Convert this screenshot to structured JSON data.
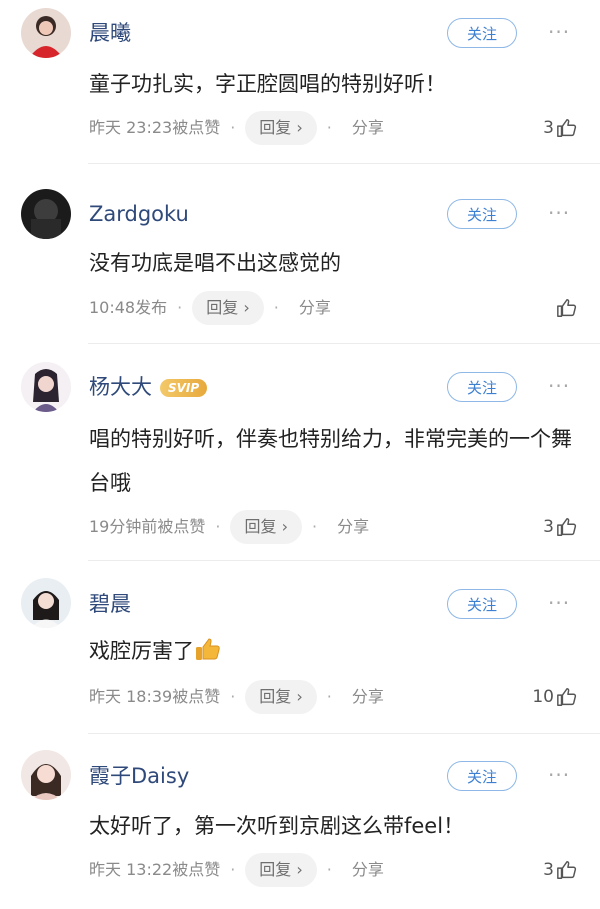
{
  "follow_label": "关注",
  "reply_label": "回复",
  "share_label": "分享",
  "separator": "·",
  "more_label": "···",
  "comments": [
    {
      "name": "晨曦",
      "text": "童子功扎实，字正腔圆唱的特别好听！",
      "time": "昨天 23:23被点赞",
      "likes": "3",
      "vip": ""
    },
    {
      "name": "Zardgoku",
      "text": "没有功底是唱不出这感觉的",
      "time": "10:48发布",
      "likes": "",
      "vip": ""
    },
    {
      "name": "杨大大",
      "text": "唱的特别好听，伴奏也特别给力，非常完美的一个舞台哦",
      "time": "19分钟前被点赞",
      "likes": "3",
      "vip": "SVIP"
    },
    {
      "name": "碧晨",
      "text": "戏腔厉害了",
      "time": "昨天 18:39被点赞",
      "likes": "10",
      "vip": ""
    },
    {
      "name": "霞子Daisy",
      "text": "太好听了，第一次听到京剧这么带feel！",
      "time": "昨天 13:22被点赞",
      "likes": "3",
      "vip": ""
    }
  ],
  "colors": {
    "name": "#2f4a7a",
    "follow_border": "#8fb8e6",
    "follow_text": "#3d7fd1",
    "meta_text": "#8a8a8a",
    "reply_bg": "#f2f2f2"
  }
}
